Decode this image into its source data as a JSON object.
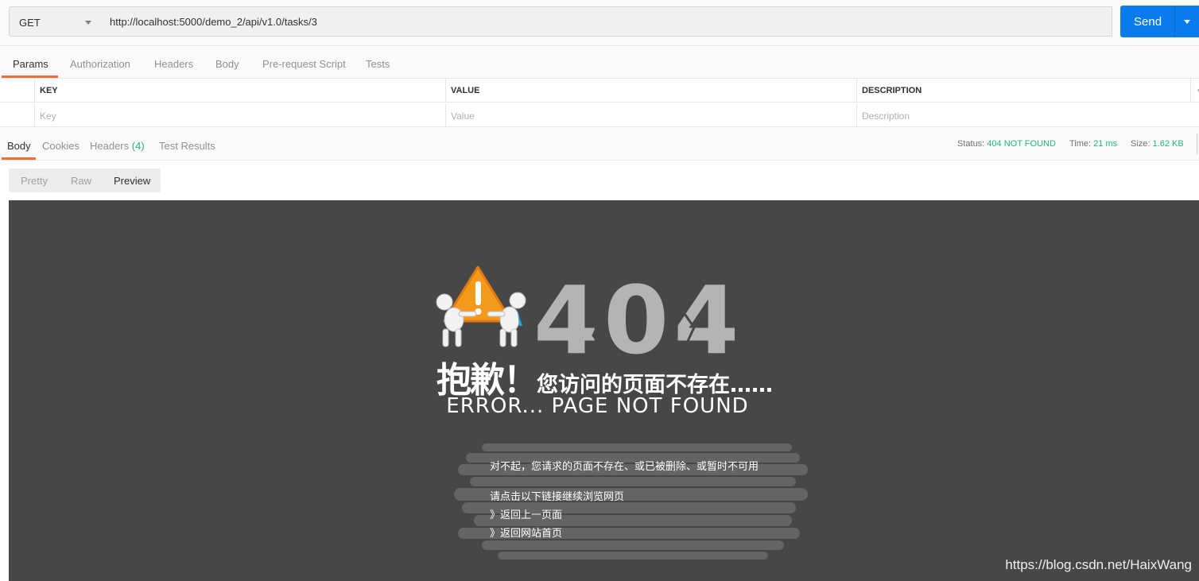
{
  "request": {
    "method": "GET",
    "url": "http://localhost:5000/demo_2/api/v1.0/tasks/3",
    "send_label": "Send"
  },
  "request_tabs": [
    "Params",
    "Authorization",
    "Headers",
    "Body",
    "Pre-request Script",
    "Tests"
  ],
  "params_table": {
    "headers": [
      "KEY",
      "VALUE",
      "DESCRIPTION"
    ],
    "placeholders": [
      "Key",
      "Value",
      "Description"
    ]
  },
  "response_tabs": {
    "body": "Body",
    "cookies": "Cookies",
    "headers": "Headers",
    "headers_count": "(4)",
    "test_results": "Test Results"
  },
  "response_stats": {
    "status_label": "Status:",
    "status_value": "404 NOT FOUND",
    "time_label": "Time:",
    "time_value": "21 ms",
    "size_label": "Size:",
    "size_value": "1.62 KB"
  },
  "view_modes": [
    "Pretty",
    "Raw",
    "Preview"
  ],
  "preview": {
    "big_code": "404",
    "sorry_big": "抱歉！",
    "sorry_small": "您访问的页面不存在……",
    "error_title": "ERROR... PAGE NOT FOUND",
    "message_1": "对不起，您请求的页面不存在、或已被删除、或暂时不可用",
    "message_2": "请点击以下链接继续浏览网页",
    "link_back": "》返回上一页面",
    "link_home": "》返回网站首页",
    "watermark": "https://blog.csdn.net/HaixWang"
  },
  "colors": {
    "accent_orange": "#f26b3a",
    "send_blue": "#097bed",
    "status_green": "#26b47f",
    "preview_bg": "#474747"
  }
}
